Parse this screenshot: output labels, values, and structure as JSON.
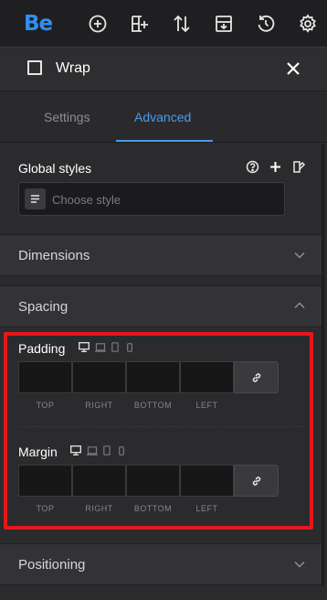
{
  "toolbar": {
    "logo": "Be",
    "icons": [
      "plus-circle-icon",
      "add-grid-icon",
      "sort-icon",
      "save-icon",
      "history-icon",
      "gear-icon"
    ]
  },
  "element": {
    "title": "Wrap"
  },
  "tabs": [
    {
      "label": "Settings",
      "active": false
    },
    {
      "label": "Advanced",
      "active": true
    }
  ],
  "global_styles": {
    "label": "Global styles",
    "placeholder": "Choose style"
  },
  "sections": {
    "dimensions": "Dimensions",
    "spacing": "Spacing",
    "positioning": "Positioning"
  },
  "padding": {
    "label": "Padding",
    "values": [
      "",
      "",
      "",
      ""
    ],
    "captions": [
      "TOP",
      "RIGHT",
      "BOTTOM",
      "LEFT"
    ]
  },
  "margin": {
    "label": "Margin",
    "values": [
      "",
      "",
      "",
      ""
    ],
    "captions": [
      "TOP",
      "RIGHT",
      "BOTTOM",
      "LEFT"
    ]
  },
  "colors": {
    "accent": "#4b9cf0",
    "logo": "#2f8ff0",
    "highlight": "#e8161a"
  }
}
